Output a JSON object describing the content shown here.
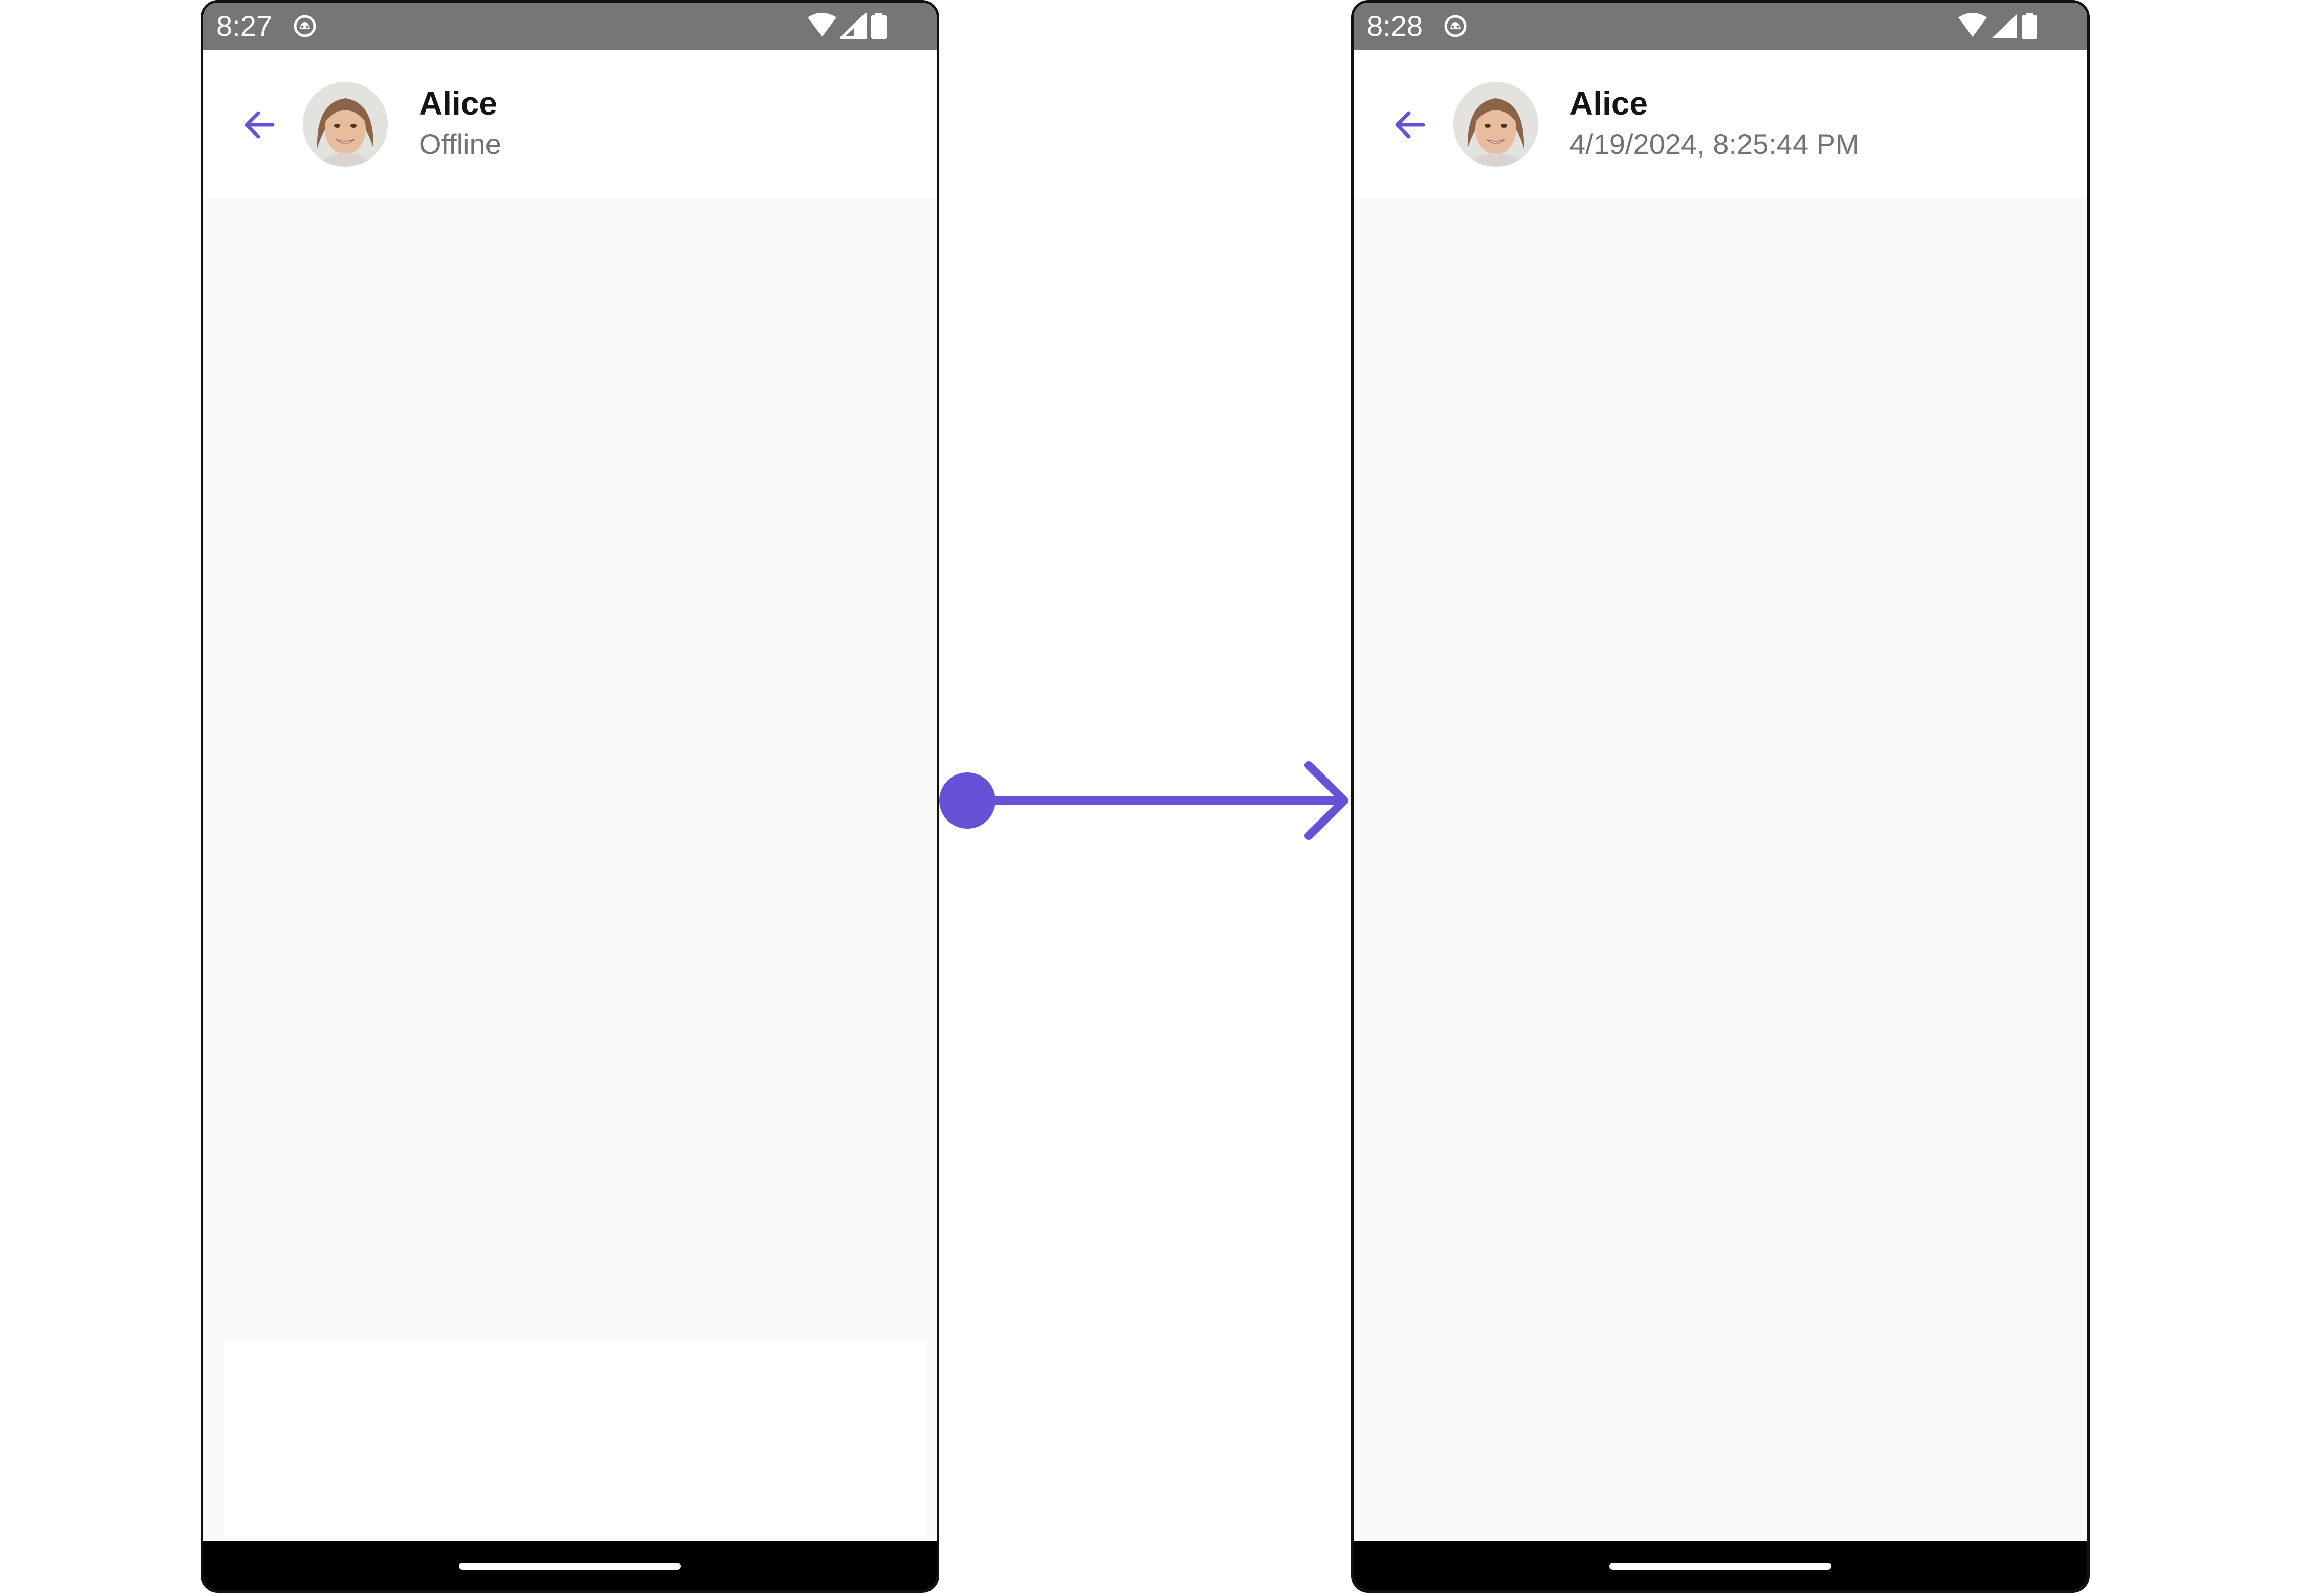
{
  "accent_color": "#6851D6",
  "left_screen": {
    "status_bar": {
      "time": "8:27",
      "app_icon": "notification-app-icon",
      "icons": [
        "wifi-icon",
        "signal-icon",
        "battery-icon"
      ]
    },
    "header": {
      "back_icon": "arrow-left-icon",
      "title": "Alice",
      "subtitle": "Offline",
      "avatar": "user-avatar-photo"
    }
  },
  "right_screen": {
    "status_bar": {
      "time": "8:28",
      "app_icon": "notification-app-icon",
      "icons": [
        "wifi-icon",
        "signal-icon",
        "battery-icon"
      ]
    },
    "header": {
      "back_icon": "arrow-left-icon",
      "title": "Alice",
      "subtitle": "4/19/2024, 8:25:44 PM",
      "avatar": "user-avatar-photo"
    }
  },
  "transition_arrow": "arrow-right-icon"
}
